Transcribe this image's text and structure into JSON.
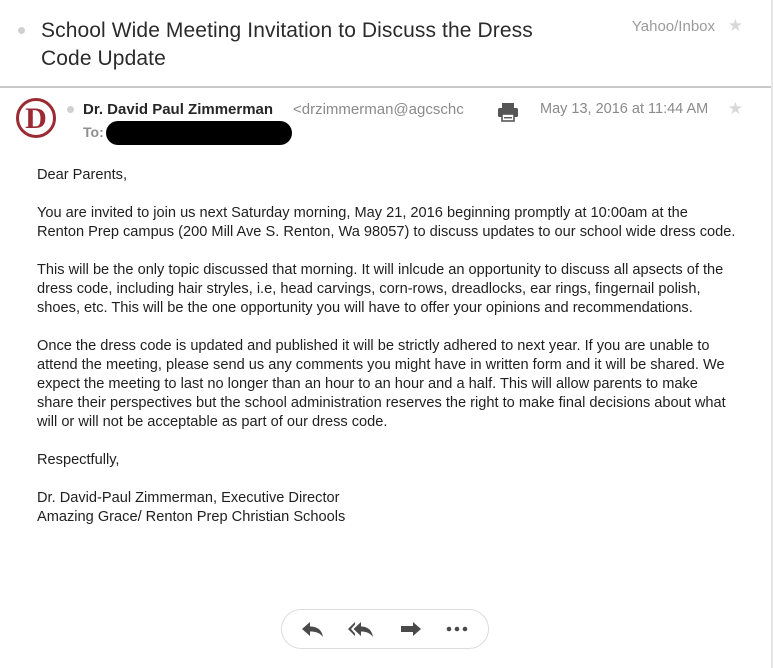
{
  "subject": {
    "title": "School Wide Meeting Invitation to Discuss the Dress Code Update",
    "folder": "Yahoo/Inbox"
  },
  "message": {
    "avatar_letter": "D",
    "sender_name": "Dr. David Paul Zimmerman",
    "sender_email": "<drzimmerman@agcschc",
    "to_label": "To:",
    "timestamp": "May 13, 2016 at 11:44 AM"
  },
  "body": {
    "greeting": "Dear Parents,",
    "paragraph_1": "You are invited to join us next Saturday morning, May 21, 2016 beginning promptly at 10:00am at the Renton Prep campus (200 Mill Ave S. Renton, Wa  98057) to discuss updates to our school wide dress code.",
    "paragraph_2": "This will be the only topic discussed that morning. It will inlcude an opportunity to discuss all apsects of the dress code, including hair stryles, i.e, head carvings, corn-rows, dreadlocks, ear rings, fingernail polish, shoes, etc. This will be the one opportunity you will have to offer your opinions and recommendations.",
    "paragraph_3": "Once the dress code is updated and published it will be strictly adhered to next year. If you are unable to attend the meeting, please send us any comments you might have in written form and it will be shared. We expect the meeting to last no longer than an hour to an hour and a half. This will allow parents to make share their perspectives but the school administration reserves the right to make final decisions about what will or will not be acceptable as part of our dress code.",
    "closing": "Respectfully,",
    "signature_line_1": "Dr. David-Paul Zimmerman, Executive Director",
    "signature_line_2": "Amazing Grace/ Renton Prep Christian Schools"
  },
  "icons": {
    "star": "star-icon",
    "print": "print-icon",
    "reply": "reply-icon",
    "reply_all": "reply-all-icon",
    "forward": "forward-icon",
    "more": "more-icon"
  },
  "colors": {
    "avatar_accent": "#9b2a33",
    "muted_text": "#8a8a8a",
    "icon_gray": "#4a4a4a"
  }
}
